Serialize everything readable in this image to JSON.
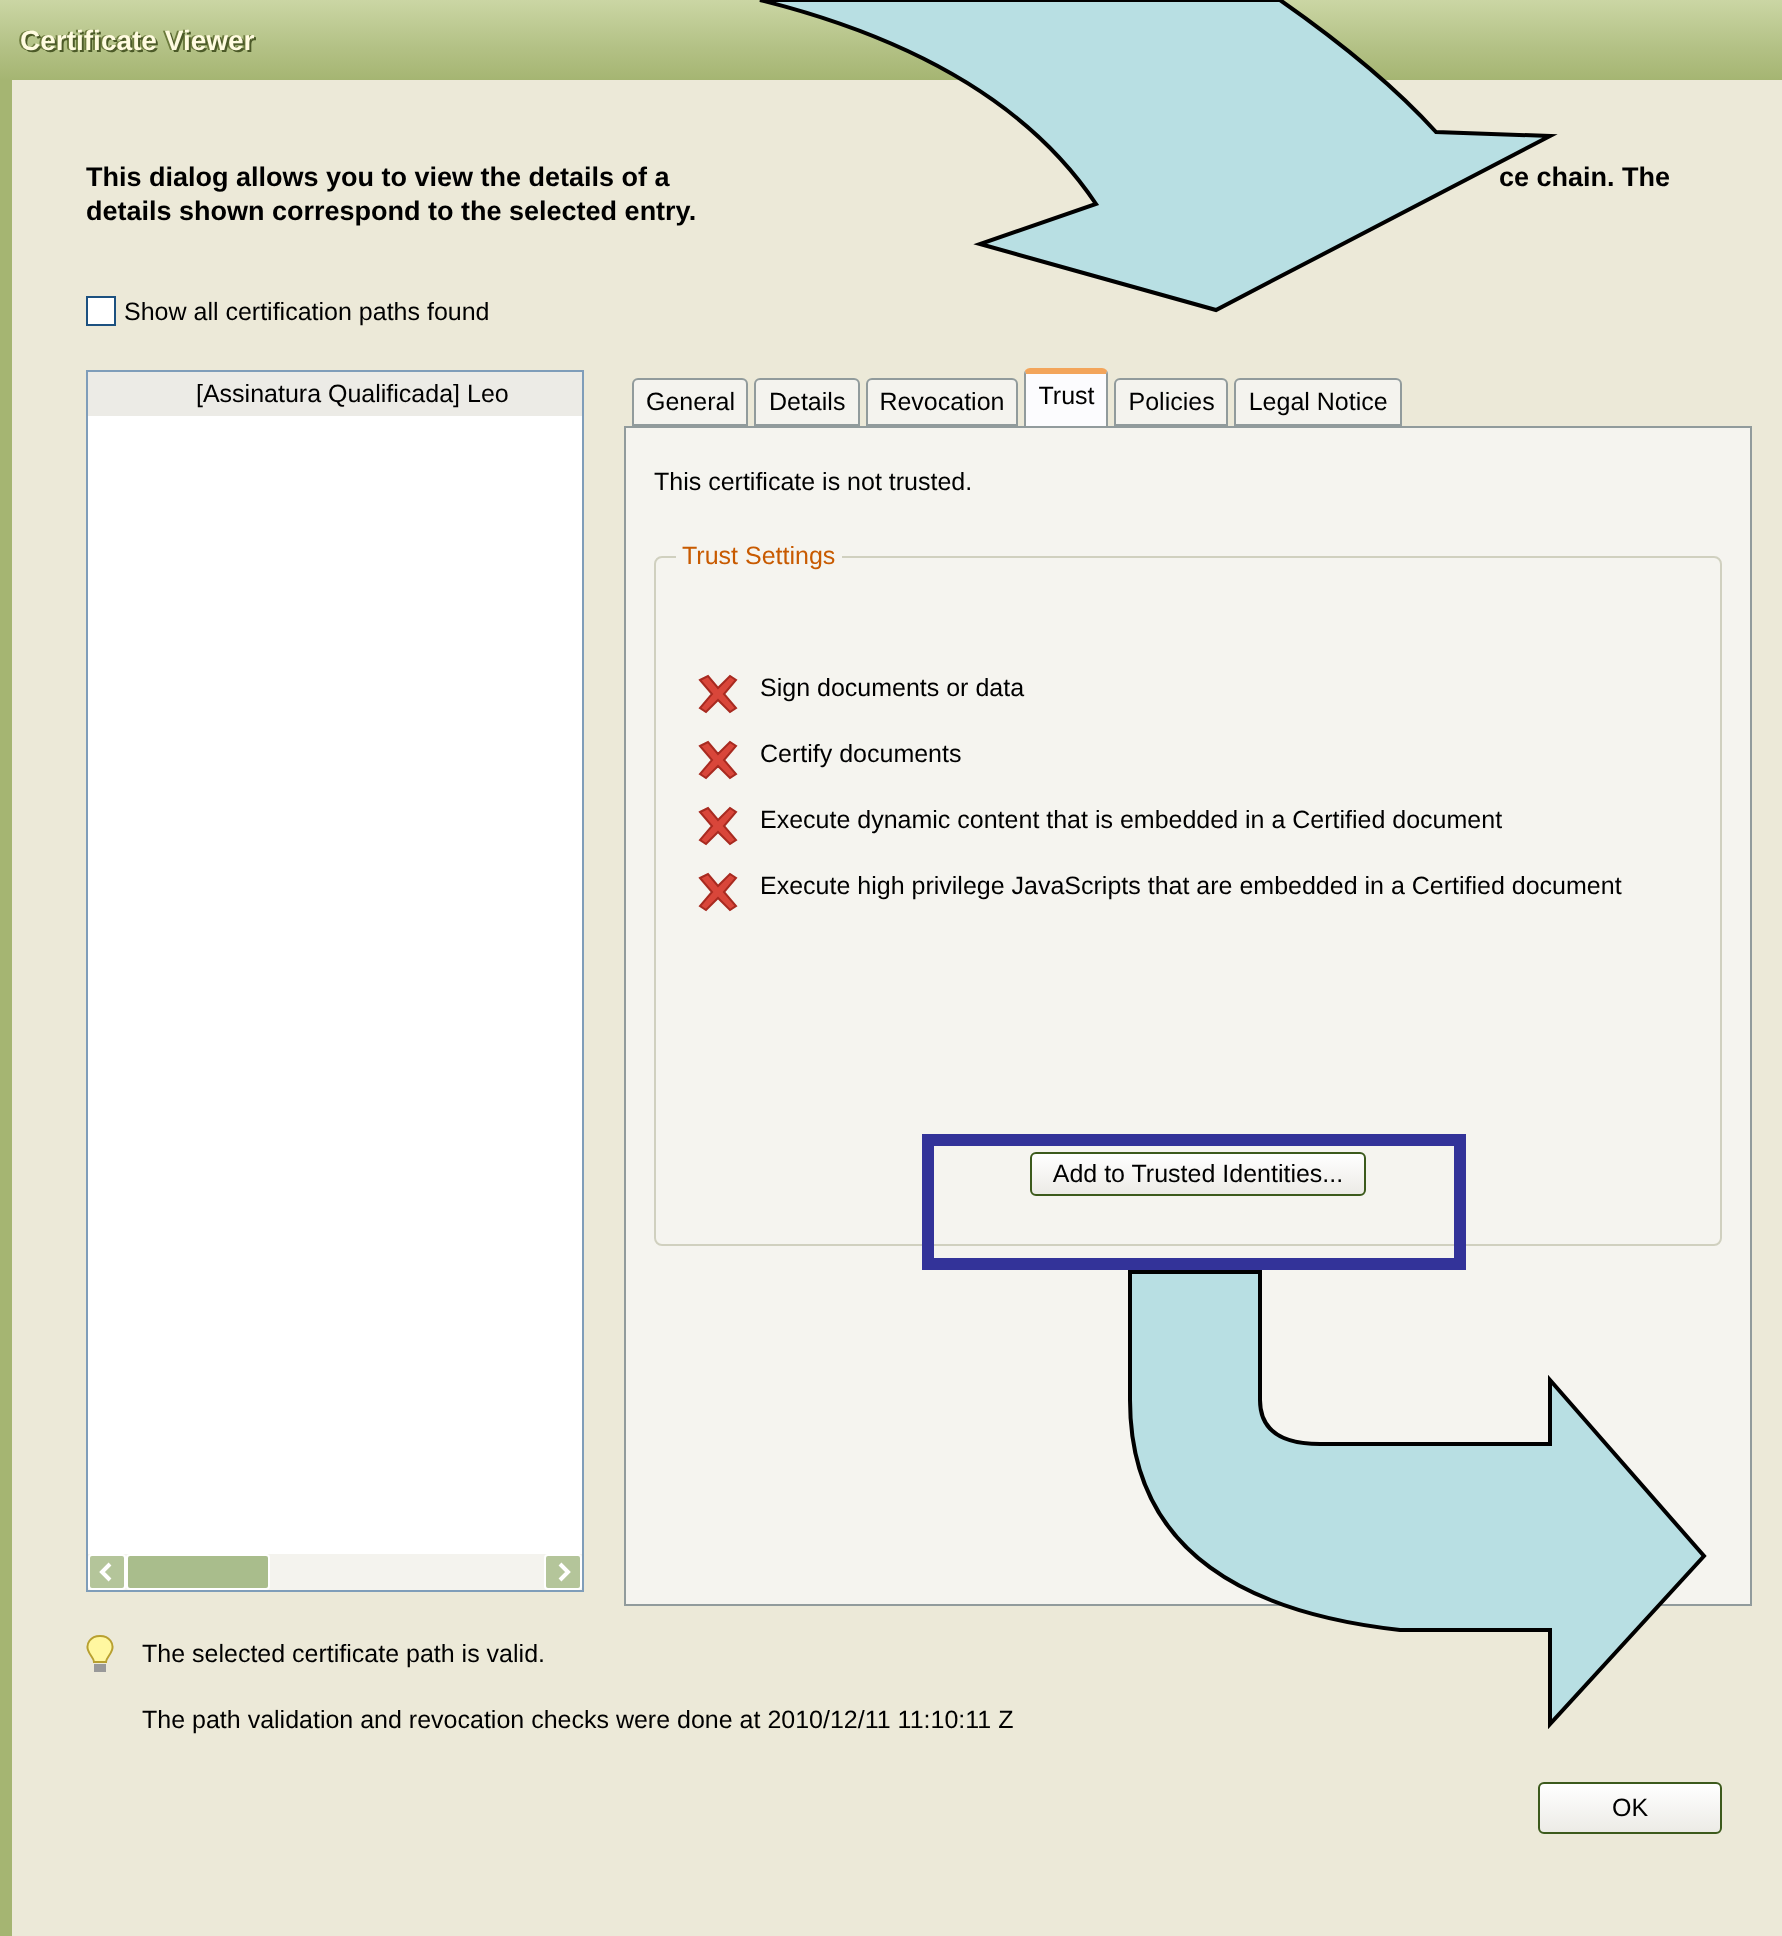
{
  "window": {
    "title": "Certificate Viewer"
  },
  "intro": {
    "line_1_start": "This dialog allows you to view the details of a",
    "line_1_end": "ce chain. The",
    "line_2": "details shown correspond to the selected entry."
  },
  "show_all_paths": {
    "label": "Show all certification paths found",
    "checked": false
  },
  "path_list": {
    "items": [
      {
        "label": "[Assinatura Qualificada] Leo",
        "selected": true
      }
    ]
  },
  "tabs": [
    {
      "label": "General",
      "selected": false
    },
    {
      "label": "Details",
      "selected": false
    },
    {
      "label": "Revocation",
      "selected": false
    },
    {
      "label": "Trust",
      "selected": true
    },
    {
      "label": "Policies",
      "selected": false
    },
    {
      "label": "Legal Notice",
      "selected": false
    }
  ],
  "trust_panel": {
    "status": "This certificate is not trusted.",
    "group_title": "Trust Settings",
    "settings": [
      {
        "label": "Sign documents or data",
        "allowed": false
      },
      {
        "label": "Certify documents",
        "allowed": false
      },
      {
        "label": "Execute dynamic content that is embedded in a Certified document",
        "allowed": false
      },
      {
        "label": "Execute high privilege JavaScripts that are embedded in a Certified document",
        "allowed": false
      }
    ],
    "button": "Add to Trusted Identities..."
  },
  "status": {
    "valid": "The selected certificate path is valid.",
    "checked_at": "The path validation and revocation checks were done at 2010/12/11 11:10:11 Z"
  },
  "buttons": [
    {
      "label": "OK"
    }
  ]
}
